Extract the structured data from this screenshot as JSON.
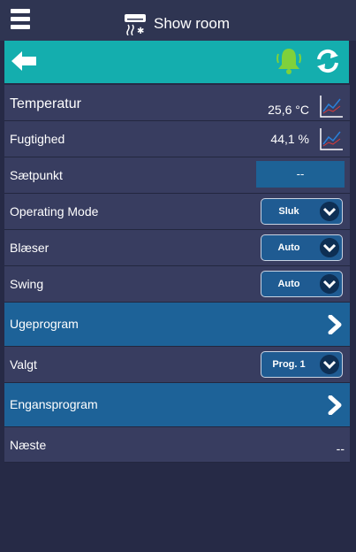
{
  "header": {
    "title": "Show room"
  },
  "rows": {
    "temperature": {
      "label": "Temperatur",
      "value": "25,6 °C"
    },
    "humidity": {
      "label": "Fugtighed",
      "value": "44,1 %"
    },
    "setpoint": {
      "label": "Sætpunkt",
      "value": "--"
    },
    "operating_mode": {
      "label": "Operating Mode",
      "value": "Sluk"
    },
    "fan": {
      "label": "Blæser",
      "value": "Auto"
    },
    "swing": {
      "label": "Swing",
      "value": "Auto"
    },
    "weekly_program": {
      "label": "Ugeprogram"
    },
    "selected": {
      "label": "Valgt",
      "value": "Prog. 1"
    },
    "single_program": {
      "label": "Engansprogram"
    },
    "next": {
      "label": "Næste",
      "value": "--"
    }
  },
  "icons": {
    "menu": "hamburger-icon",
    "device": "air-conditioner-icon",
    "back": "back-arrow-icon",
    "alarm": "bell-icon",
    "refresh": "refresh-icon",
    "chart": "chart-icon",
    "dropdown": "chevron-down-icon",
    "navigate": "chevron-right-icon"
  },
  "colors": {
    "background": "#262a46",
    "topbar": "#2f3552",
    "actionbar": "#14aeae",
    "row": "#383d60",
    "nav_row": "#1d6298",
    "bell": "#7fd13b"
  }
}
